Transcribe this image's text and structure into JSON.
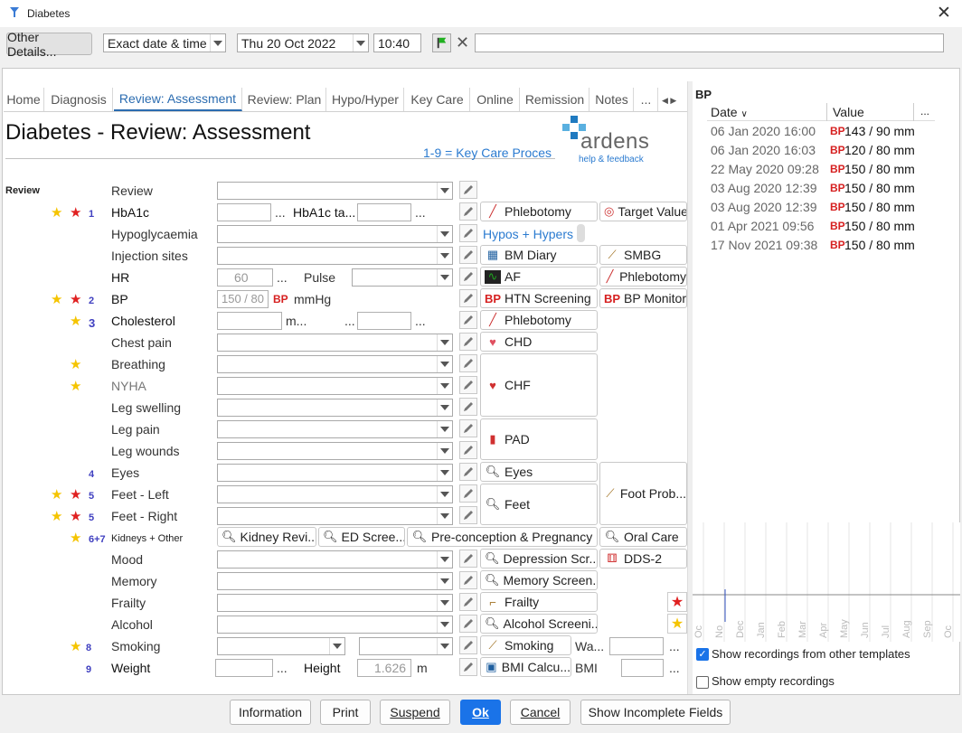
{
  "window": {
    "title": "Diabetes"
  },
  "toolbar": {
    "other_details": "Other Details...",
    "date_mode": "Exact date & time",
    "date": "Thu 20 Oct 2022",
    "time": "10:40"
  },
  "tabs": [
    "Home",
    "Diagnosis",
    "Review: Assessment",
    "Review: Plan",
    "Hypo/Hyper",
    "Key Care",
    "Online",
    "Remission",
    "Notes",
    "..."
  ],
  "page": {
    "title": "Diabetes - Review: Assessment",
    "key_care_link": "1-9 = Key Care Proces",
    "brand": "ardens",
    "brand_sub": "help & feedback",
    "section": "Review"
  },
  "rows": {
    "review": "Review",
    "hba1c": "HbA1c",
    "hba1c_target": "HbA1c ta...",
    "hypo": "Hypoglycaemia",
    "inj": "Injection sites",
    "hr": "HR",
    "hr_ph": "60",
    "pulse": "Pulse",
    "bp": "BP",
    "bp_ph": "150 / 80",
    "bp_tag": "BP",
    "bp_unit": "mmHg",
    "chol": "Cholesterol",
    "chol_unit": "m...",
    "chest": "Chest pain",
    "breath": "Breathing",
    "nyha": "NYHA",
    "legsw": "Leg swelling",
    "legpain": "Leg pain",
    "legw": "Leg wounds",
    "eyes": "Eyes",
    "feetl": "Feet - Left",
    "feetr": "Feet - Right",
    "kidneys": "Kidneys + Other",
    "mood": "Mood",
    "memory": "Memory",
    "frailty": "Frailty",
    "alcohol": "Alcohol",
    "smoking": "Smoking",
    "weight": "Weight",
    "height": "Height",
    "height_ph": "1.626",
    "height_unit": "m",
    "dots": "...",
    "n1": "1",
    "n2": "2",
    "n3": "3",
    "n4": "4",
    "n5": "5",
    "n67": "6+7",
    "n8": "8",
    "n9": "9"
  },
  "buttons": {
    "phleb1": "Phlebotomy",
    "target": "Target Value",
    "hypos": "Hypos + Hypers",
    "bmdiary": "BM Diary",
    "smbg": "SMBG",
    "af": "AF",
    "phleb2": "Phlebotomy",
    "htn": "HTN Screening",
    "bpmon": "BP Monitorin",
    "phleb3": "Phlebotomy",
    "chd": "CHD",
    "chf": "CHF",
    "pad": "PAD",
    "eyes": "Eyes",
    "feet": "Feet",
    "footprob": "Foot Prob...",
    "kidney": "Kidney Revi...",
    "ed": "ED Scree...",
    "precon": "Pre-conception & Pregnancy",
    "oral": "Oral Care",
    "depr": "Depression Scr...",
    "dds": "DDS-2",
    "memscr": "Memory Screen...",
    "frailty": "Frailty",
    "alcscr": "Alcohol Screeni...",
    "smoking": "Smoking",
    "wa": "Wa...",
    "bmi": "BMI Calcu...",
    "bmi_lbl": "BMI"
  },
  "bp_panel": {
    "title": "BP",
    "col_date": "Date",
    "col_value": "Value",
    "col_more": "...",
    "tag": "BP",
    "rows": [
      {
        "date": "06 Jan 2020 16:00",
        "value": "143 / 90 mm"
      },
      {
        "date": "06 Jan 2020 16:03",
        "value": "120 / 80 mm"
      },
      {
        "date": "22 May 2020 09:28",
        "value": "150 / 80 mm"
      },
      {
        "date": "03 Aug 2020 12:39",
        "value": "150 / 80 mm"
      },
      {
        "date": "03 Aug 2020 12:39",
        "value": "150 / 80 mm"
      },
      {
        "date": "01 Apr 2021 09:56",
        "value": "150 / 80 mm"
      },
      {
        "date": "17 Nov 2021 09:38",
        "value": "150 / 80 mm"
      }
    ],
    "months": [
      "Oc",
      "No",
      "Dec",
      "Jan",
      "Feb",
      "Mar",
      "Apr",
      "May",
      "Jun",
      "Jul",
      "Aug",
      "Sep",
      "Oc"
    ],
    "chk1": "Show recordings from other templates",
    "chk2": "Show empty recordings"
  },
  "footer": {
    "info": "Information",
    "print": "Print",
    "suspend": "Suspend",
    "ok": "Ok",
    "cancel": "Cancel",
    "incomplete": "Show Incomplete Fields"
  }
}
